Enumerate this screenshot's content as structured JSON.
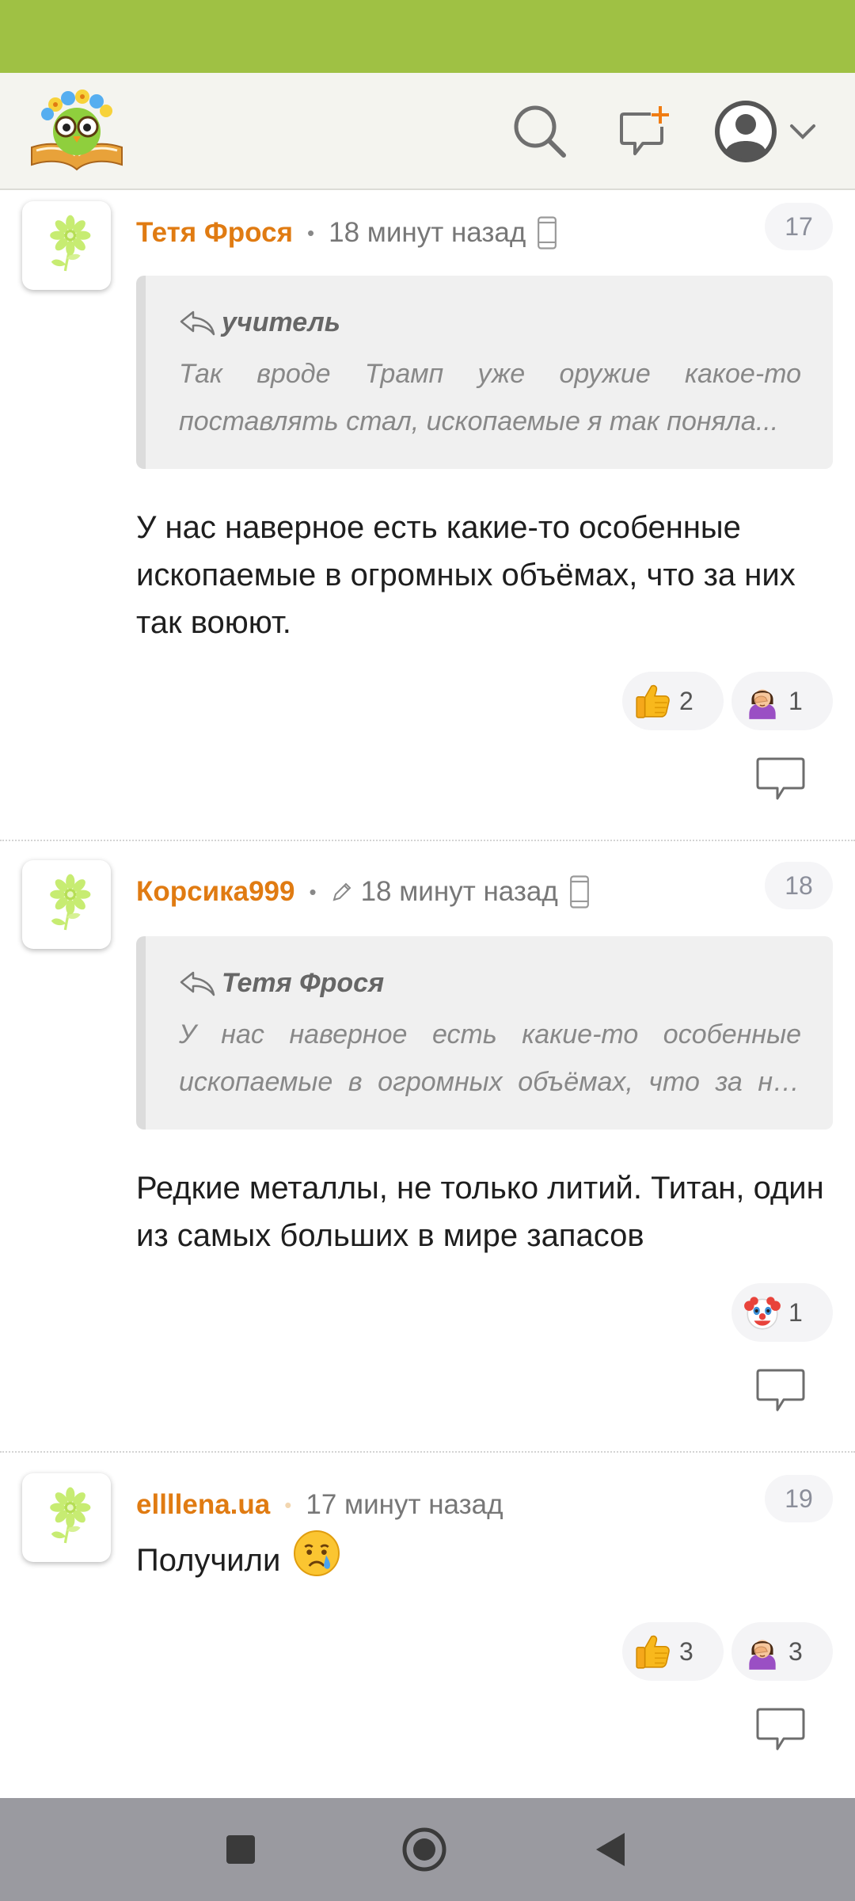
{
  "header": {
    "logo_icon": "owl-reading-book-logo",
    "search_icon": "search-icon",
    "new_post_icon": "new-message-icon",
    "profile_icon": "user-avatar-icon"
  },
  "colors": {
    "status_bar": "#9fc144",
    "header_bg": "#f4f4ef",
    "author": "#e07b12",
    "navbar": "#9a9aa0"
  },
  "comments": [
    {
      "author": "Тетя Фрося",
      "time": "18 минут назад",
      "edited": false,
      "device": "mobile",
      "number": "17",
      "quote": {
        "author": "учитель",
        "text": "Так вроде Трамп уже оружие какое-то поставлять стал, ископаемые я так поняла..."
      },
      "text": "У нас наверное есть какие-то особенные ископаемые в огромных объёмах, что за них так воюют.",
      "reactions": [
        {
          "icon": "thumbs-up",
          "count": "2"
        },
        {
          "icon": "facepalm",
          "count": "1"
        }
      ]
    },
    {
      "author": "Корсика999",
      "time": "18 минут назад",
      "edited": true,
      "device": "mobile",
      "number": "18",
      "quote": {
        "author": "Тетя Фрося",
        "text": "У нас наверное есть какие-то особенные ископаемые в огромных объёмах, что за них так воюют."
      },
      "text": "Редкие металлы, не только литий. Титан, один из самых больших в мире запасов",
      "reactions": [
        {
          "icon": "clown",
          "count": "1"
        }
      ]
    },
    {
      "author": "ellllena.ua",
      "time": "17 минут назад",
      "edited": false,
      "device": "none",
      "number": "19",
      "text": "Получили",
      "text_emoji": "crying-face",
      "reactions": [
        {
          "icon": "thumbs-up",
          "count": "3"
        },
        {
          "icon": "facepalm",
          "count": "3"
        }
      ]
    }
  ],
  "navbar": {
    "recent_icon": "square-icon",
    "home_icon": "circle-icon",
    "back_icon": "back-triangle-icon"
  }
}
